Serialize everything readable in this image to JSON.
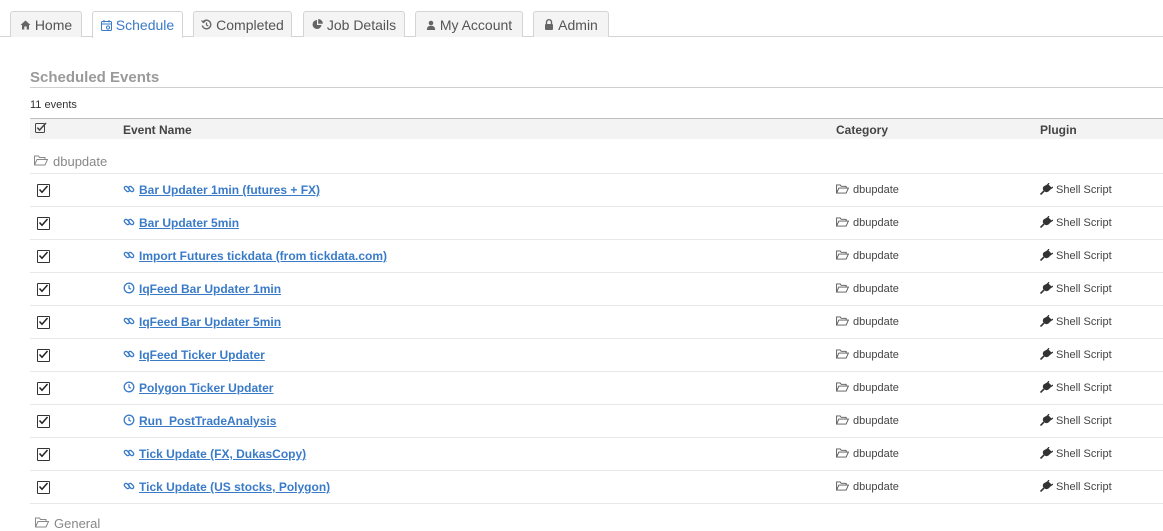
{
  "tabs": [
    {
      "label": "Home",
      "icon": "home-icon",
      "active": false
    },
    {
      "label": "Schedule",
      "icon": "calendar-icon",
      "active": true
    },
    {
      "label": "Completed",
      "icon": "history-icon",
      "active": false
    },
    {
      "label": "Job Details",
      "icon": "pie-chart-icon",
      "active": false
    },
    {
      "label": "My Account",
      "icon": "user-icon",
      "active": false
    },
    {
      "label": "Admin",
      "icon": "lock-icon",
      "active": false
    }
  ],
  "section": {
    "title": "Scheduled Events",
    "count": "11 events"
  },
  "columns": {
    "name": "Event Name",
    "category": "Category",
    "plugin": "Plugin"
  },
  "group": {
    "name": "dbupdate",
    "next_group": "General"
  },
  "colors": {
    "link": "#3a7bc8",
    "active_tab": "#3a7bc8",
    "muted": "#9a9a9a"
  },
  "events": [
    {
      "name": "Bar Updater 1min (futures + FX)",
      "icon": "link-icon",
      "category": "dbupdate",
      "plugin": "Shell Script",
      "enabled": true
    },
    {
      "name": "Bar Updater 5min",
      "icon": "link-icon",
      "category": "dbupdate",
      "plugin": "Shell Script",
      "enabled": true
    },
    {
      "name": "Import Futures tickdata (from tickdata.com)",
      "icon": "link-icon",
      "category": "dbupdate",
      "plugin": "Shell Script",
      "enabled": true
    },
    {
      "name": "IqFeed Bar Updater 1min",
      "icon": "clock-icon",
      "category": "dbupdate",
      "plugin": "Shell Script",
      "enabled": true
    },
    {
      "name": "IqFeed Bar Updater 5min",
      "icon": "link-icon",
      "category": "dbupdate",
      "plugin": "Shell Script",
      "enabled": true
    },
    {
      "name": "IqFeed Ticker Updater",
      "icon": "link-icon",
      "category": "dbupdate",
      "plugin": "Shell Script",
      "enabled": true
    },
    {
      "name": "Polygon Ticker Updater",
      "icon": "clock-icon",
      "category": "dbupdate",
      "plugin": "Shell Script",
      "enabled": true
    },
    {
      "name": "Run_PostTradeAnalysis",
      "icon": "clock-icon",
      "category": "dbupdate",
      "plugin": "Shell Script",
      "enabled": true
    },
    {
      "name": "Tick Update (FX, DukasCopy)",
      "icon": "link-icon",
      "category": "dbupdate",
      "plugin": "Shell Script",
      "enabled": true
    },
    {
      "name": "Tick Update (US stocks, Polygon)",
      "icon": "link-icon",
      "category": "dbupdate",
      "plugin": "Shell Script",
      "enabled": true
    }
  ]
}
